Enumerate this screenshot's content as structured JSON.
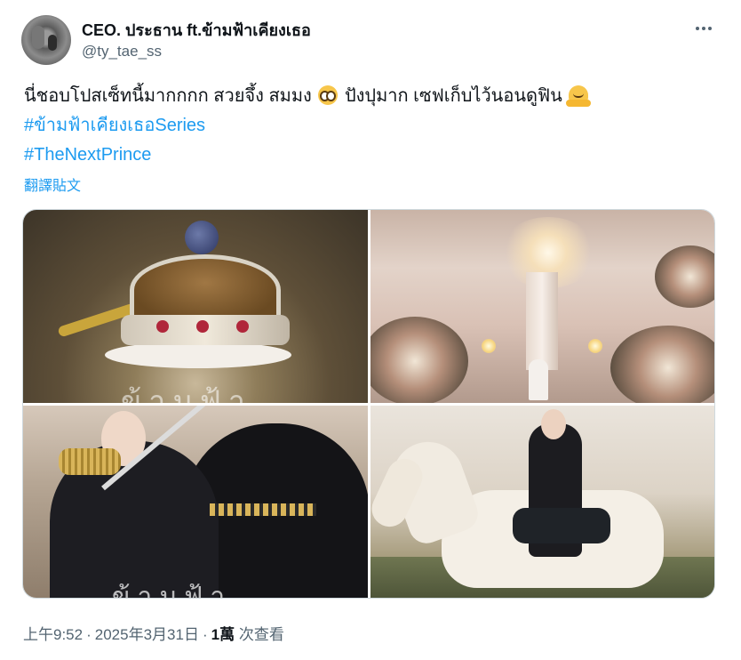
{
  "user": {
    "display_name": "CEO. ประธาน ft.ข้ามฟ้าเคียงเธอ",
    "handle": "@ty_tae_ss"
  },
  "tweet": {
    "text_part1": "นี่ชอบโปสเซ็ทนี้มากกกก สวยจึ้ง สมมง",
    "emoji1": "pleading-face-emoji",
    "text_part2": " ปังปุมาก เซฟเก็บไว้นอนดูฟิน",
    "emoji2": "melting-face-emoji",
    "hashtag1": "#ข้ามฟ้าเคียงเธอSeries",
    "hashtag2": "#TheNextPrince",
    "translate_label": "翻譯貼文"
  },
  "media": {
    "images": [
      {
        "name": "crown-photo",
        "caption": "ข้ามฟ้า"
      },
      {
        "name": "chapel-photo",
        "caption": ""
      },
      {
        "name": "soldiers-photo",
        "caption": "ข้ามฟ้า"
      },
      {
        "name": "horse-photo",
        "caption": ""
      }
    ]
  },
  "meta": {
    "time": "上午9:52",
    "separator": "·",
    "date": "2025年3月31日",
    "views_count": "1萬",
    "views_label": "次查看"
  },
  "colors": {
    "link": "#1d9bf0",
    "secondary_text": "#536471",
    "primary_text": "#0f1419",
    "border": "#cfd9de"
  },
  "icons": {
    "more": "more-horizontal-icon"
  }
}
